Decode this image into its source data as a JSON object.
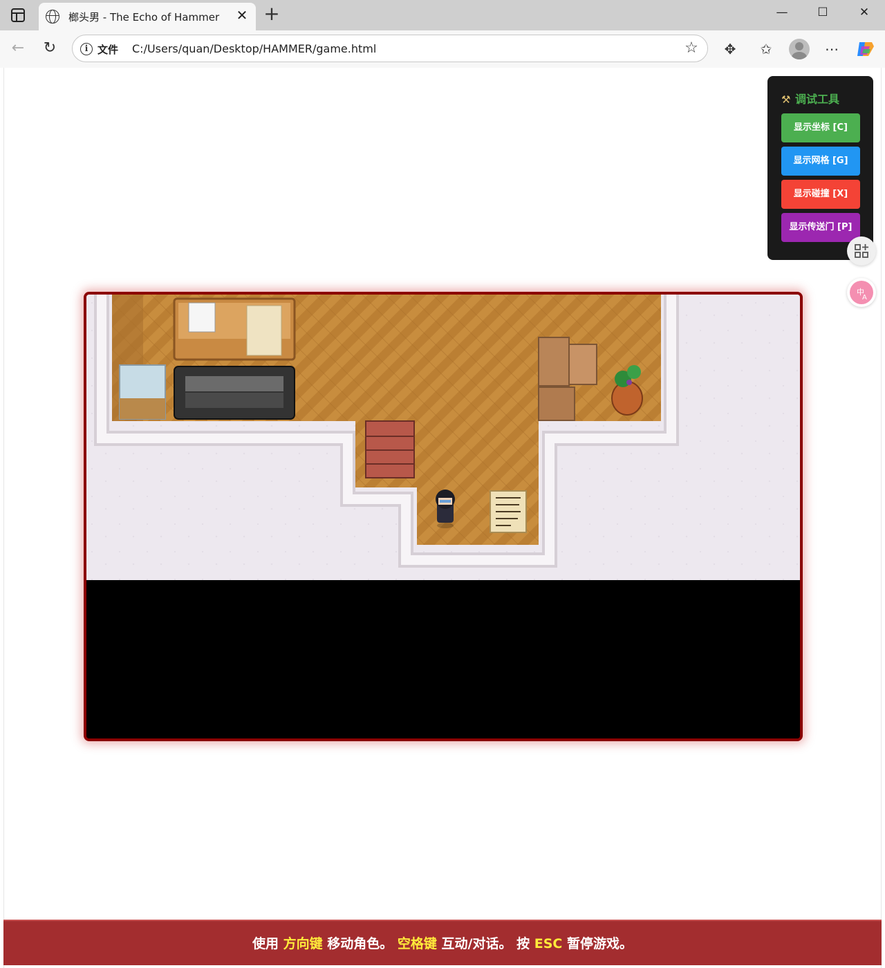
{
  "browser": {
    "tab_title": "榔头男 - The Echo of Hammer",
    "address_scheme_label": "文件",
    "url": "C:/Users/quan/Desktop/HAMMER/game.html"
  },
  "debug_panel": {
    "title": "调试工具",
    "buttons": [
      {
        "label": "显示坐标 [C]",
        "color": "#4caf50"
      },
      {
        "label": "显示网格 [G]",
        "color": "#2196f3"
      },
      {
        "label": "显示碰撞 [X]",
        "color": "#f44336"
      },
      {
        "label": "显示传送门 [P]",
        "color": "#9c27b0"
      }
    ]
  },
  "hint": {
    "p1": "使用 ",
    "k1": "方向键",
    "p2": " 移动角色。 ",
    "k2": "空格键",
    "p3": " 互动/对话。 按 ",
    "k3": "ESC",
    "p4": " 暂停游戏。"
  },
  "colors": {
    "frame_border": "#8b0000",
    "hint_bar": "#a32d2f",
    "hint_key": "#ffeb3b",
    "panel_bg": "#1a1a1a",
    "panel_title": "#4caf50"
  },
  "icons": [
    "globe-icon",
    "close-icon",
    "plus-icon",
    "info-icon",
    "star-icon",
    "extensions-icon",
    "favorites-icon",
    "more-icon",
    "copilot-icon",
    "tools-icon",
    "apps-icon",
    "translate-icon"
  ]
}
